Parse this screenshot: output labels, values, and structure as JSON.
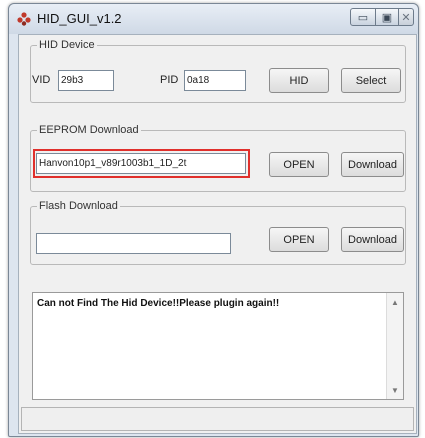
{
  "window": {
    "title": "HID_GUI_v1.2",
    "controls": {
      "minimize": "▭",
      "maximize": "▣",
      "close": "✕"
    }
  },
  "hid_device": {
    "legend": "HID Device",
    "vid_label": "VID",
    "vid_value": "29b3",
    "pid_label": "PID",
    "pid_value": "0a18",
    "hid_button": "HID",
    "select_button": "Select"
  },
  "eeprom": {
    "legend": "EEPROM Download",
    "file_value": "Hanvon10p1_v89r1003b1_1D_2t",
    "open_button": "OPEN",
    "download_button": "Download",
    "highlight_color": "#e0302c"
  },
  "flash": {
    "legend": "Flash Download",
    "file_value": "",
    "open_button": "OPEN",
    "download_button": "Download"
  },
  "messages": {
    "text": "Can not Find The Hid Device!!Please plugin again!!"
  },
  "status": {
    "text": ""
  },
  "icons": {
    "app": "app-icon",
    "scroll_up": "scroll-up-arrow-icon",
    "scroll_down": "scroll-down-arrow-icon"
  }
}
